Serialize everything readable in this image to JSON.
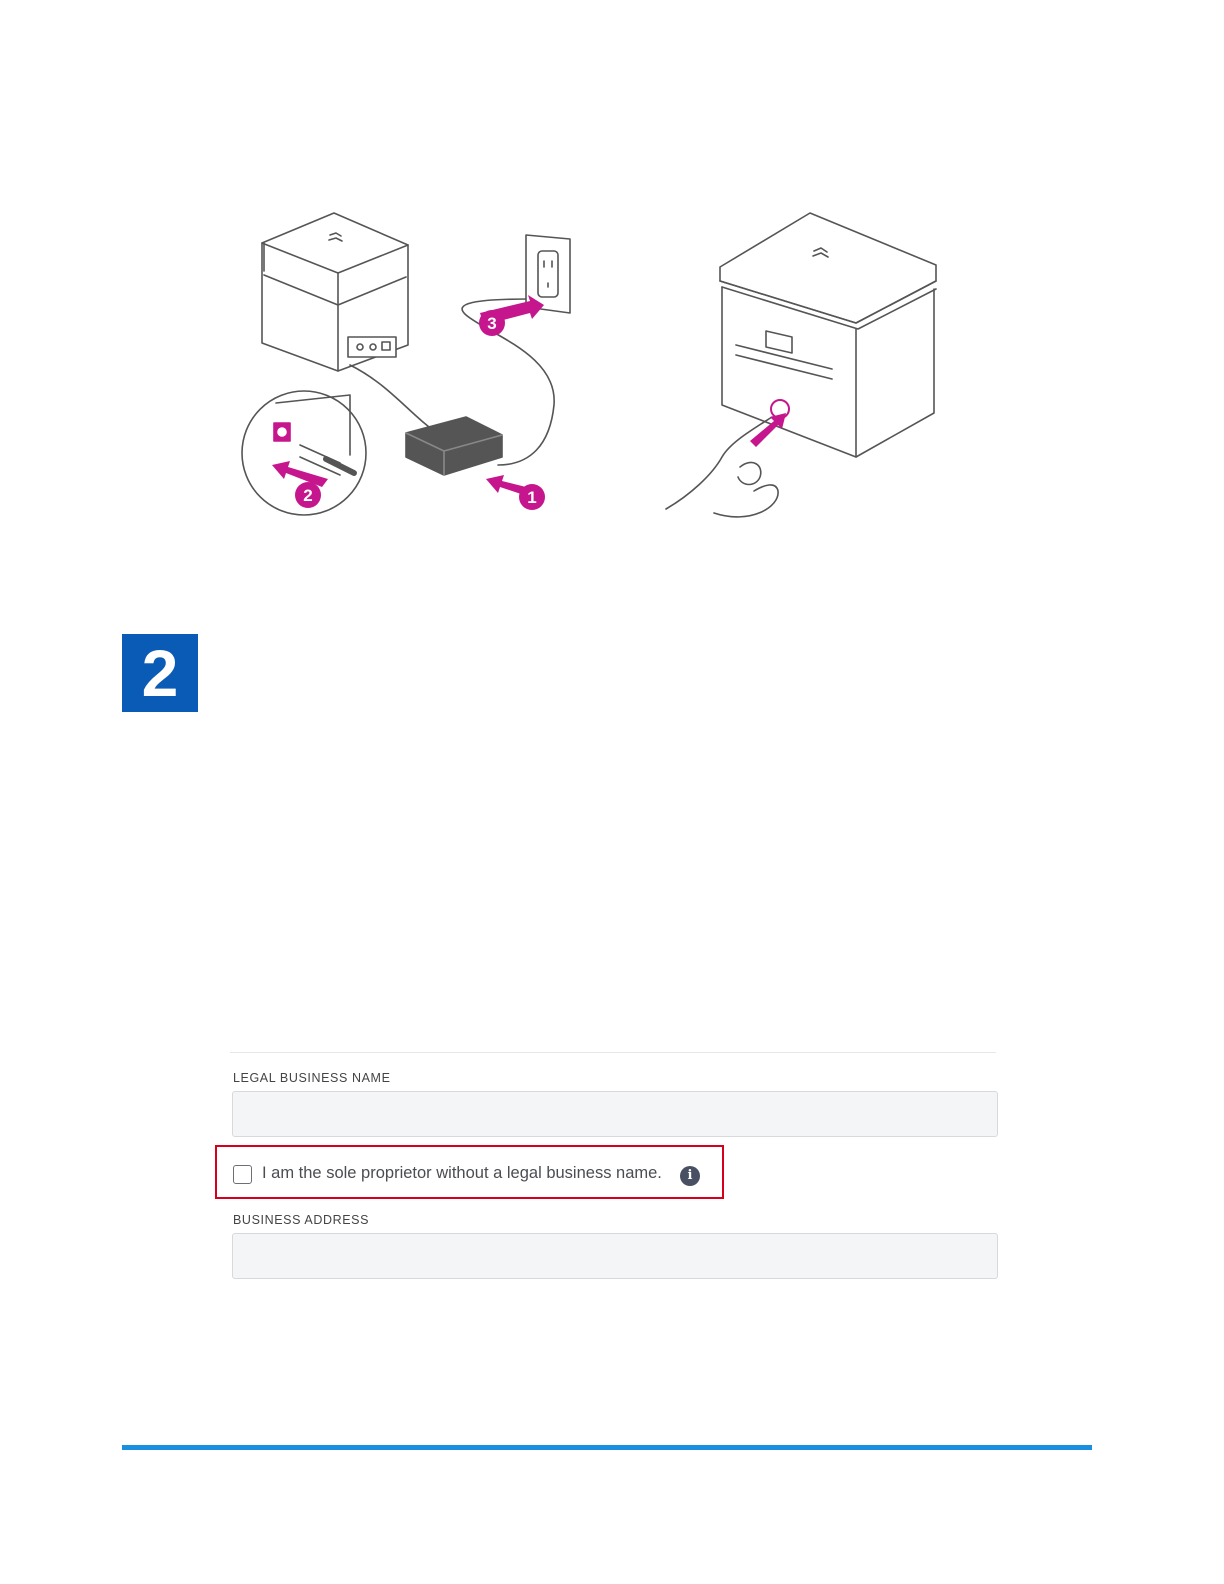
{
  "step": {
    "number": "2"
  },
  "illustration": {
    "callouts": [
      "1",
      "2",
      "3"
    ],
    "accent_color": "#c6168d",
    "icons": [
      "printer-back-icon",
      "power-adapter-icon",
      "wall-outlet-icon",
      "printer-front-icon",
      "power-button-icon",
      "finger-press-icon"
    ]
  },
  "form": {
    "legal_business_name_label": "LEGAL BUSINESS NAME",
    "legal_business_name_value": "",
    "sole_proprietor_label": "I am the sole proprietor without a legal business name.",
    "sole_proprietor_checked": false,
    "info_glyph": "i",
    "business_address_label": "BUSINESS ADDRESS",
    "business_address_value": "",
    "highlight_color": "#d6001c"
  },
  "colors": {
    "step_badge": "#0a5bb5",
    "footer_rule": "#1a8fe0"
  }
}
